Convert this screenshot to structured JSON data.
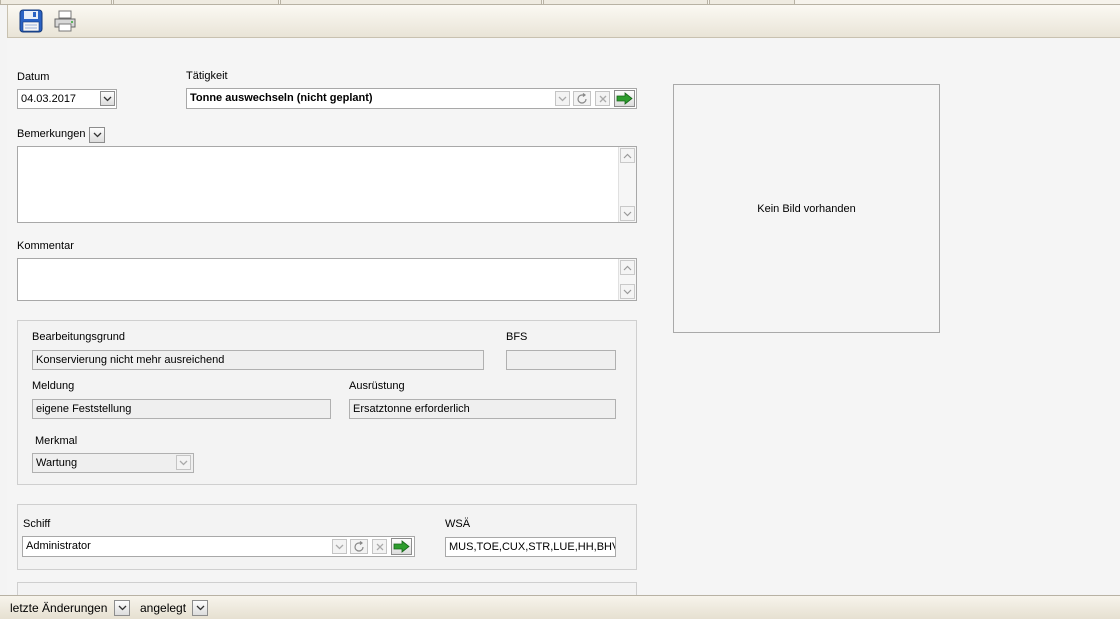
{
  "toolbar": {
    "save_icon": "floppy-disk-icon",
    "print_icon": "printer-icon"
  },
  "form": {
    "datum": {
      "label": "Datum",
      "value": "04.03.2017"
    },
    "taetigkeit": {
      "label": "Tätigkeit",
      "value": "Tonne auswechseln (nicht geplant)"
    },
    "bemerkungen": {
      "label": "Bemerkungen",
      "value": ""
    },
    "kommentar": {
      "label": "Kommentar",
      "value": ""
    },
    "bearbeitungsgrund": {
      "label": "Bearbeitungsgrund",
      "value": "Konservierung nicht mehr ausreichend"
    },
    "bfs": {
      "label": "BFS",
      "value": ""
    },
    "meldung": {
      "label": "Meldung",
      "value": "eigene Feststellung"
    },
    "ausruestung": {
      "label": "Ausrüstung",
      "value": "Ersatztonne erforderlich"
    },
    "merkmal": {
      "label": "Merkmal",
      "value": "Wartung"
    },
    "schiff": {
      "label": "Schiff",
      "value": "Administrator"
    },
    "wsa": {
      "label": "WSÄ",
      "value": "MUS,TOE,CUX,STR,LUE,HH,BHV,W"
    }
  },
  "image": {
    "placeholder": "Kein Bild vorhanden"
  },
  "statusbar": {
    "last_changes": "letzte Änderungen",
    "created": "angelegt"
  },
  "colors": {
    "accent_green": "#2e9d2e",
    "save_blue": "#1c4fa0"
  }
}
